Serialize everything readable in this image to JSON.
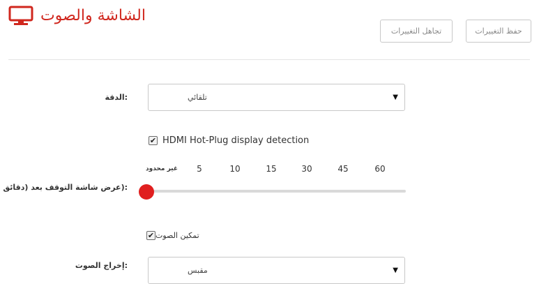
{
  "header": {
    "title": "الشاشة والصوت",
    "icon": "monitor-icon",
    "accent_color": "#d0271e",
    "discard_label": "تجاهل التغييرات",
    "save_label": "حفظ التغييرات"
  },
  "resolution": {
    "label": ":الدقة",
    "value": "تلقائي"
  },
  "hdmi": {
    "label": "HDMI Hot-Plug display detection",
    "checked": true
  },
  "screensaver": {
    "label": ":(عرض شاشة التوقف بعد (دقائق",
    "ticks": [
      "غير محدود",
      "5",
      "10",
      "15",
      "30",
      "45",
      "60"
    ],
    "selected_value": "غير محدود",
    "thumb_color": "#e01f1f"
  },
  "audio": {
    "enable_label": "تمكين الصوت",
    "enabled": true,
    "output_label": ":إخراج الصوت",
    "output_value": "مقبس"
  },
  "icons": {
    "check": "✔",
    "dropdown_arrow": "▼"
  }
}
